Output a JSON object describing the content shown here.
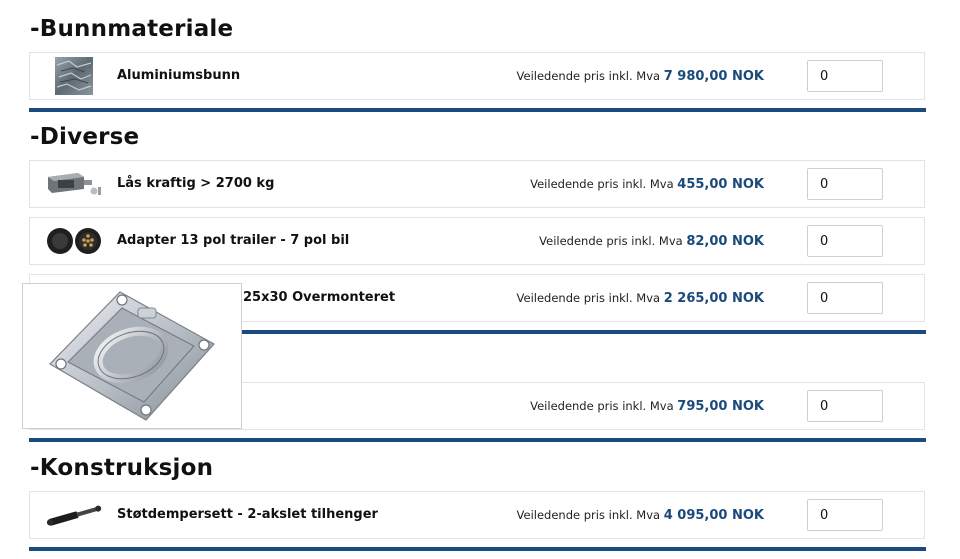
{
  "price_prefix": "Veiledende pris inkl. Mva",
  "sections": [
    {
      "title": "-Bunnmateriale"
    },
    {
      "title": "-Diverse"
    },
    {
      "title": "-Konstruksjon"
    }
  ],
  "products": [
    {
      "name": "Aluminiumsbunn",
      "price": "7 980,00 NOK",
      "qty": "0"
    },
    {
      "name": "Lås kraftig > 2700 kg",
      "price": "455,00 NOK",
      "qty": "0"
    },
    {
      "name": "Adapter 13 pol trailer - 7 pol bil",
      "price": "82,00 NOK",
      "qty": "0"
    },
    {
      "name": "25x30 Overmonteret",
      "price": "2 265,00 NOK",
      "qty": "0"
    },
    {
      "name": "",
      "price": "795,00 NOK",
      "qty": "0"
    },
    {
      "name": "Støtdempersett - 2-akslet tilhenger",
      "price": "4 095,00 NOK",
      "qty": "0"
    }
  ]
}
